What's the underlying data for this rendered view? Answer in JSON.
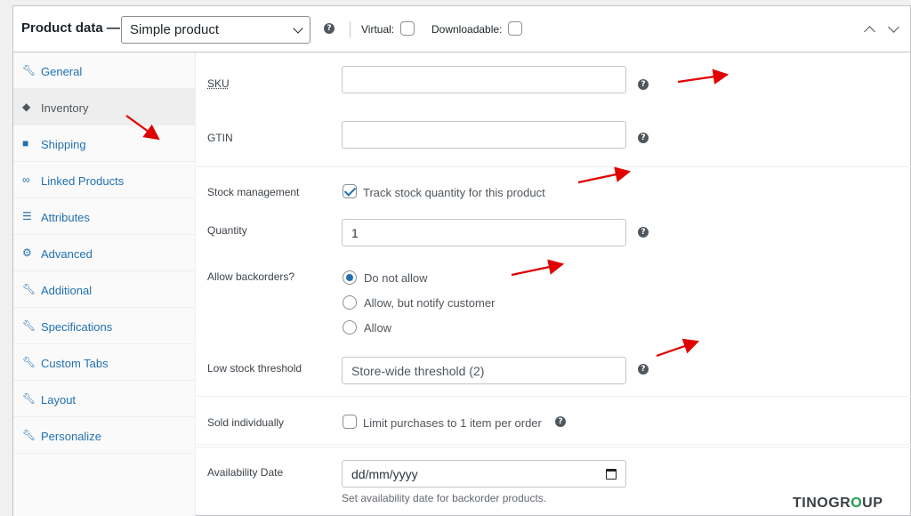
{
  "header": {
    "title": "Product data —",
    "product_type": "Simple product",
    "virtual_label": "Virtual:",
    "downloadable_label": "Downloadable:"
  },
  "tabs": [
    {
      "label": "General",
      "icon": "wrench-icon"
    },
    {
      "label": "Inventory",
      "icon": "tag-icon",
      "active": true
    },
    {
      "label": "Shipping",
      "icon": "truck-icon"
    },
    {
      "label": "Linked Products",
      "icon": "link-icon"
    },
    {
      "label": "Attributes",
      "icon": "list-icon"
    },
    {
      "label": "Advanced",
      "icon": "gear-icon"
    },
    {
      "label": "Additional",
      "icon": "wrench-icon"
    },
    {
      "label": "Specifications",
      "icon": "wrench-icon"
    },
    {
      "label": "Custom Tabs",
      "icon": "wrench-icon"
    },
    {
      "label": "Layout",
      "icon": "wrench-icon"
    },
    {
      "label": "Personalize",
      "icon": "wrench-icon"
    }
  ],
  "inventory": {
    "sku_label": "SKU",
    "sku_value": "",
    "gtin_label": "GTIN",
    "gtin_value": "",
    "stock_mgmt_label": "Stock management",
    "stock_mgmt_option": "Track stock quantity for this product",
    "stock_mgmt_checked": true,
    "quantity_label": "Quantity",
    "quantity_value": "1",
    "backorders_label": "Allow backorders?",
    "backorder_options": [
      "Do not allow",
      "Allow, but notify customer",
      "Allow"
    ],
    "backorder_selected": "Do not allow",
    "low_stock_label": "Low stock threshold",
    "low_stock_placeholder": "Store-wide threshold (2)",
    "sold_individually_label": "Sold individually",
    "sold_individually_option": "Limit purchases to 1 item per order",
    "availability_label": "Availability Date",
    "availability_placeholder": "dd/mm/yyyy",
    "availability_desc": "Set availability date for backorder products."
  },
  "brand": {
    "part1": "TINO",
    "part2": "GR",
    "part3": "O",
    "part4": "UP"
  },
  "colors": {
    "accent": "#2271b1",
    "annotation_arrow": "#e00000",
    "brand_green": "#1a9e4a"
  }
}
